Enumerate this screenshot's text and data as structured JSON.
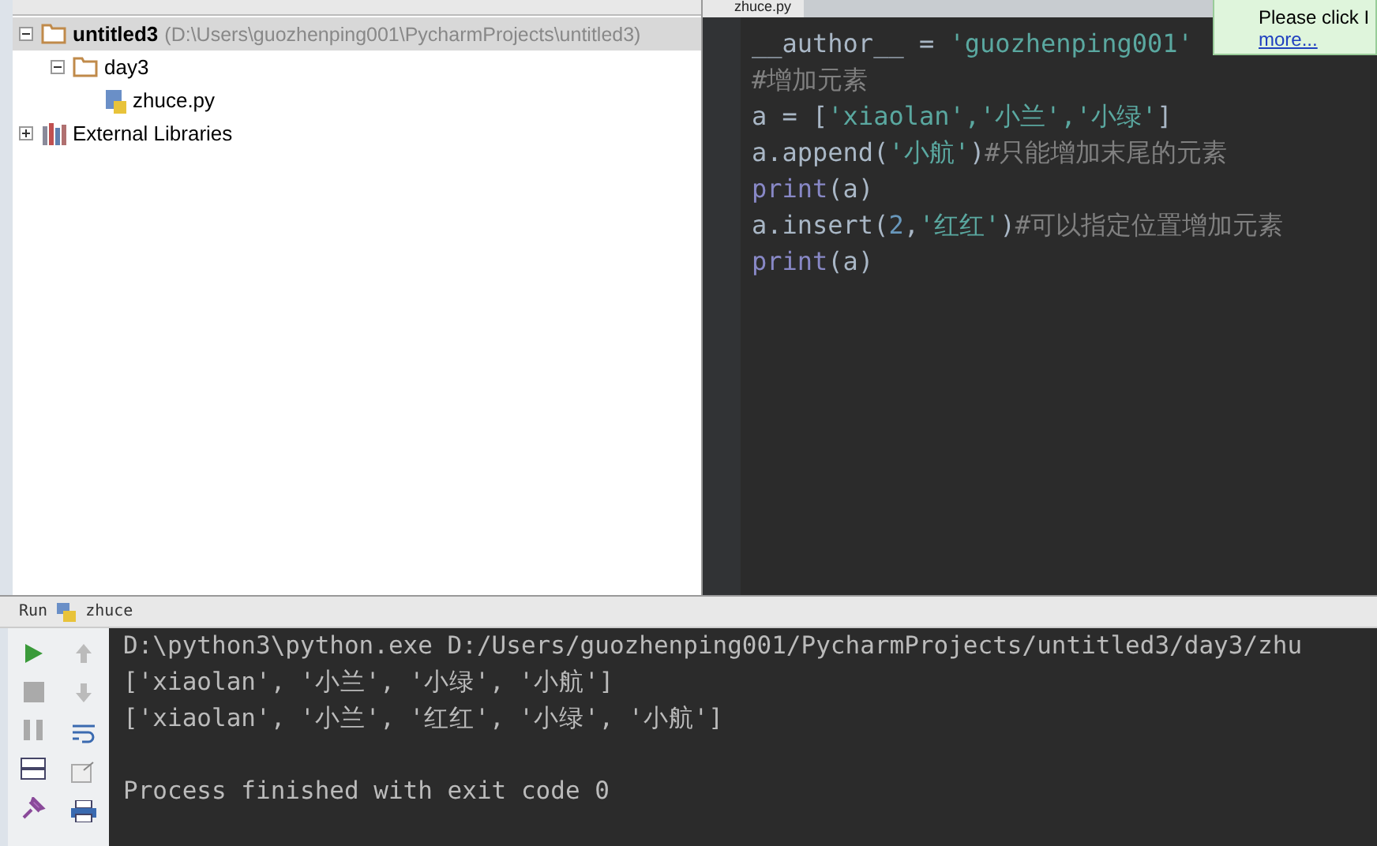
{
  "project_tree": [
    {
      "label": "untitled3",
      "path": "(D:\\Users\\guozhenping001\\PycharmProjects\\untitled3)",
      "kind": "folder",
      "expanded": true,
      "selected": true,
      "children": [
        {
          "label": "day3",
          "kind": "folder",
          "expanded": true,
          "selected": false,
          "children": [
            {
              "label": "zhuce.py",
              "kind": "python",
              "selected": false
            }
          ]
        }
      ]
    },
    {
      "label": "External Libraries",
      "kind": "library",
      "expanded": false,
      "selected": false
    }
  ],
  "editor_tab": {
    "label": "zhuce.py"
  },
  "notification": {
    "text": "Please click I",
    "link": "more..."
  },
  "code_lines": [
    [
      {
        "kind": "plain",
        "text": "__author__ = "
      },
      {
        "kind": "string",
        "text": "'guozhenping001'"
      }
    ],
    [
      {
        "kind": "comment",
        "text": "#增加元素"
      }
    ],
    [
      {
        "kind": "plain",
        "text": "a = ["
      },
      {
        "kind": "string",
        "text": "'xiaolan','小兰','小绿'"
      },
      {
        "kind": "plain",
        "text": "]"
      }
    ],
    [
      {
        "kind": "plain",
        "text": "a.append("
      },
      {
        "kind": "string",
        "text": "'小航'"
      },
      {
        "kind": "plain",
        "text": ")"
      },
      {
        "kind": "comment",
        "text": "#只能增加末尾的元素"
      }
    ],
    [
      {
        "kind": "builtin",
        "text": "print"
      },
      {
        "kind": "plain",
        "text": "(a)"
      }
    ],
    [
      {
        "kind": "plain",
        "text": "a.insert("
      },
      {
        "kind": "number",
        "text": "2"
      },
      {
        "kind": "plain",
        "text": ","
      },
      {
        "kind": "string",
        "text": "'红红'"
      },
      {
        "kind": "plain",
        "text": ")"
      },
      {
        "kind": "comment",
        "text": "#可以指定位置增加元素"
      }
    ],
    [
      {
        "kind": "builtin",
        "text": "print"
      },
      {
        "kind": "plain",
        "text": "(a)"
      }
    ]
  ],
  "run_panel": {
    "label": "Run",
    "config": "zhuce"
  },
  "console_lines": [
    "D:\\python3\\python.exe D:/Users/guozhenping001/PycharmProjects/untitled3/day3/zhu",
    "['xiaolan', '小兰', '小绿', '小航']",
    "['xiaolan', '小兰', '红红', '小绿', '小航']"
  ],
  "exit_message": "Process finished with exit code 0"
}
